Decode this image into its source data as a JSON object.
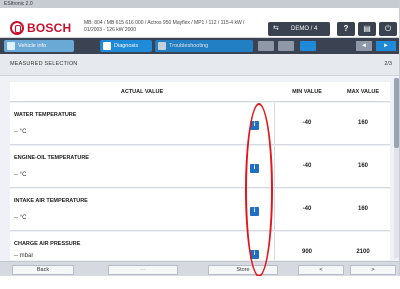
{
  "window": {
    "title": "ESItronic 2.0"
  },
  "header": {
    "brand": "BOSCH",
    "vehicle_info_line1": "MB: 804 / MB 615 616 000 / Actros 950 Mayflex / MP1 / 112 / 115-4 kW /",
    "vehicle_info_line2": "01/2003 - 126 kW 2000",
    "session_label": "DEMO / 4",
    "session_icon": "swap-arrows-icon",
    "help_label": "?",
    "print_icon": "printer-icon",
    "power_icon": "power-icon"
  },
  "tabs": [
    {
      "label": "Vehicle info",
      "icon": "car-icon"
    },
    {
      "label": "Diagnosis",
      "icon": "diagnosis-icon"
    },
    {
      "label": "Troubleshooting",
      "icon": "troubleshooting-icon"
    }
  ],
  "toolbar": {
    "prev_label": "◄",
    "next_label": "►"
  },
  "section": {
    "title": "MEASURED SELECTION",
    "page": "2/3"
  },
  "table": {
    "headers": {
      "actual": "ACTUAL VALUE",
      "min": "MIN VALUE",
      "max": "MAX VALUE"
    },
    "rows": [
      {
        "name": "WATER TEMPERATURE",
        "value": "-- °C",
        "min": "-40",
        "max": "160"
      },
      {
        "name": "ENGINE-OIL TEMPERATURE",
        "value": "-- °C",
        "min": "-40",
        "max": "160"
      },
      {
        "name": "INTAKE AIR TEMPERATURE",
        "value": "-- °C",
        "min": "-40",
        "max": "160"
      },
      {
        "name": "CHARGE AIR PRESSURE",
        "value": "-- mbar",
        "min": "900",
        "max": "2100"
      }
    ],
    "info_icon_label": "i"
  },
  "bottom": {
    "back": "Back",
    "disabled": "---",
    "store": "Store",
    "prev": "<",
    "next": ">"
  },
  "colors": {
    "accent": "#1f8ad8",
    "brand": "#c8102e",
    "annotation": "#e3151c"
  }
}
